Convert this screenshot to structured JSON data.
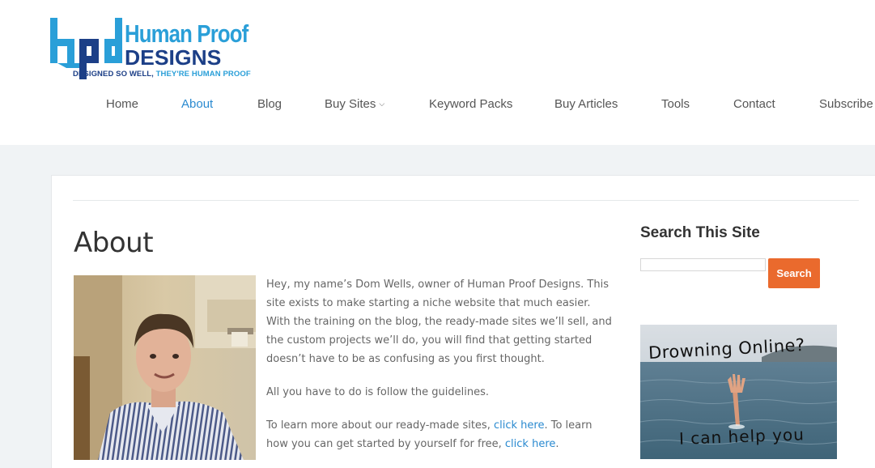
{
  "brand": {
    "line1": "Human Proof",
    "line2": "DESIGNS",
    "tagline_a": "DESIGNED SO WELL, ",
    "tagline_b": "THEY'RE HUMAN PROOF",
    "colors": {
      "light_blue": "#2a9fd8",
      "dark_blue": "#1c3f87"
    }
  },
  "nav": {
    "items": [
      {
        "label": "Home",
        "active": false
      },
      {
        "label": "About",
        "active": true
      },
      {
        "label": "Blog",
        "active": false
      },
      {
        "label": "Buy Sites",
        "active": false,
        "has_dropdown": true
      },
      {
        "label": "Keyword Packs",
        "active": false
      },
      {
        "label": "Buy Articles",
        "active": false
      },
      {
        "label": "Tools",
        "active": false
      },
      {
        "label": "Contact",
        "active": false
      },
      {
        "label": "Subscribe",
        "active": false
      }
    ],
    "caret_icon": "chevron-down-icon",
    "active_color": "#2a8ad0"
  },
  "page": {
    "title": "About",
    "p1": "Hey, my name’s Dom Wells, owner of Human Proof Designs. This site exists to make starting a niche website that much easier. With the training on the blog, the ready-made sites we’ll sell, and the custom projects we’ll do, you will find that getting started doesn’t have to be as confusing as you first thought.",
    "p2": "All you have to do is follow the guidelines.",
    "p3_a": "To learn more about our ready-made sites, ",
    "p3_link1": "click here",
    "p3_b": ". To learn how you can get started by yourself for free, ",
    "p3_link2": "click here",
    "p3_c": "."
  },
  "sidebar": {
    "search_title": "Search This Site",
    "search_value": "",
    "search_placeholder": "",
    "search_button": "Search",
    "button_color": "#ea6a2d",
    "banner_line1": "Drowning Online?",
    "banner_line2": "I can help you"
  }
}
